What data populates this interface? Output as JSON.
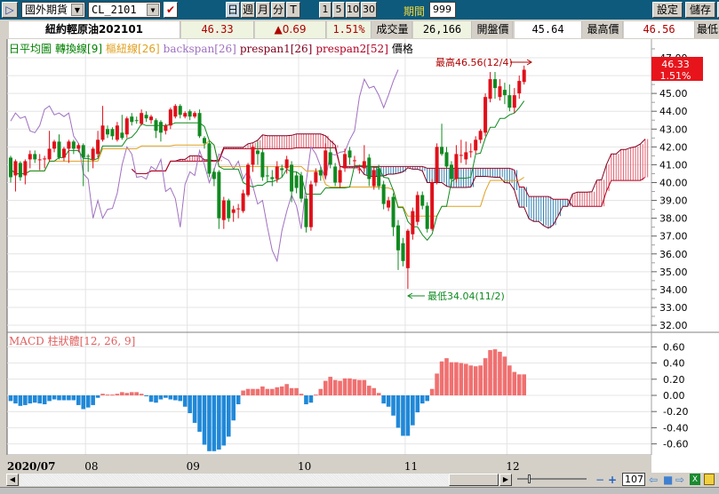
{
  "toolbar": {
    "play_icon": "play-icon",
    "market_select": "國外期貨",
    "symbol_input": "CL_2101",
    "checkbox_checked": true,
    "period_buttons": [
      "日",
      "週",
      "月",
      "分",
      "T"
    ],
    "active_period": "日",
    "count_buttons": [
      "1",
      "5",
      "10",
      "30"
    ],
    "period_label": "期間",
    "period_value": "999",
    "settings_label": "設定",
    "save_label": "儲存"
  },
  "info": {
    "name": "紐約輕原油202101",
    "last": "46.33",
    "change": "▲0.69",
    "change_pct": "1.51%",
    "volume_label": "成交量",
    "volume": "26,166",
    "open_label": "開盤價",
    "open": "45.64",
    "high_label": "最高價",
    "high": "46.56",
    "low_label": "最低"
  },
  "legend": [
    {
      "text": "日平均圖",
      "color": "#008000"
    },
    {
      "text": "轉換線[9]",
      "color": "#008000"
    },
    {
      "text": "樞紐線[26]",
      "color": "#e0a020"
    },
    {
      "text": "backspan[26]",
      "color": "#a070c0"
    },
    {
      "text": "prespan1[26]",
      "color": "#800020"
    },
    {
      "text": "prespan2[52]",
      "color": "#b00020"
    },
    {
      "text": "價格",
      "color": "#000000"
    }
  ],
  "price_tag": {
    "value": "46.33",
    "pct": "1.51%"
  },
  "annotations": {
    "high": "最高46.56(12/4)",
    "low": "最低34.04(11/2)"
  },
  "macd_title": "MACD 柱狀體[12, 26, 9]",
  "colors": {
    "up": "#e0101a",
    "down": "#108a20",
    "tenkan": "#108a20",
    "kijun": "#e0a020",
    "chikou": "#a070c0",
    "span_a": "#800020",
    "span_b": "#b00020",
    "cloud_up": "#e06070",
    "cloud_down": "#3080b0",
    "macd_pos": "#f07070",
    "macd_neg": "#2088d8"
  },
  "chart_data": [
    {
      "type": "candlestick",
      "title": "",
      "ylim": [
        32,
        47
      ],
      "yticks": [
        "47.00",
        "46.00",
        "45.00",
        "44.00",
        "43.00",
        "42.00",
        "41.00",
        "40.00",
        "39.00",
        "38.00",
        "37.00",
        "36.00",
        "35.00",
        "34.00",
        "33.00",
        "32.00"
      ],
      "xtick_labels": [
        {
          "index": 0,
          "label": "2020/07"
        },
        {
          "index": 16,
          "label": "08"
        },
        {
          "index": 37,
          "label": "09"
        },
        {
          "index": 60,
          "label": "10"
        },
        {
          "index": 82,
          "label": "11"
        },
        {
          "index": 103,
          "label": "12"
        }
      ],
      "ohlc": [
        [
          41.4,
          41.5,
          40.0,
          40.3
        ],
        [
          40.4,
          41.3,
          39.5,
          41.2
        ],
        [
          41.1,
          41.2,
          40.1,
          40.3
        ],
        [
          40.4,
          41.3,
          39.9,
          41.2
        ],
        [
          41.3,
          41.8,
          40.8,
          41.6
        ],
        [
          41.6,
          41.8,
          41.1,
          41.3
        ],
        [
          41.3,
          41.6,
          40.7,
          41.3
        ],
        [
          41.3,
          41.5,
          40.8,
          41.35
        ],
        [
          41.3,
          42.9,
          41.2,
          41.9
        ],
        [
          41.9,
          42.4,
          41.7,
          42.3
        ],
        [
          42.3,
          42.7,
          41.3,
          41.4
        ],
        [
          41.4,
          42.0,
          41.2,
          41.9
        ],
        [
          41.9,
          42.4,
          41.1,
          42.3
        ],
        [
          42.3,
          42.4,
          41.6,
          41.9
        ],
        [
          41.9,
          42.2,
          41.7,
          42.1
        ],
        [
          42.1,
          42.2,
          39.8,
          41.4
        ],
        [
          41.5,
          41.6,
          40.6,
          41.45
        ],
        [
          41.3,
          42.0,
          40.8,
          41.9
        ],
        [
          41.6,
          42.9,
          41.4,
          42.4
        ],
        [
          42.4,
          44.3,
          42.3,
          43.2
        ],
        [
          43.0,
          43.2,
          42.5,
          42.7
        ],
        [
          43.0,
          43.1,
          42.4,
          42.6
        ],
        [
          42.4,
          43.4,
          42.3,
          43.2
        ],
        [
          42.8,
          43.8,
          42.4,
          42.5
        ],
        [
          42.7,
          43.7,
          42.5,
          43.6
        ],
        [
          43.7,
          43.9,
          43.2,
          43.4
        ],
        [
          43.5,
          43.7,
          43.3,
          43.45
        ],
        [
          43.3,
          44.1,
          43.2,
          43.9
        ],
        [
          43.8,
          44.0,
          43.4,
          43.6
        ],
        [
          43.5,
          43.8,
          43.3,
          43.7
        ],
        [
          43.5,
          43.6,
          42.5,
          42.9
        ],
        [
          43.4,
          43.5,
          42.3,
          42.8
        ],
        [
          42.9,
          43.3,
          42.7,
          43.2
        ],
        [
          43.2,
          44.2,
          43.0,
          44.1
        ],
        [
          43.7,
          44.4,
          43.6,
          44.3
        ],
        [
          44.3,
          44.4,
          43.6,
          43.8
        ],
        [
          43.7,
          44.0,
          43.6,
          43.9
        ],
        [
          44.0,
          44.1,
          43.5,
          43.7
        ],
        [
          43.7,
          44.0,
          43.6,
          43.9
        ],
        [
          43.9,
          44.1,
          42.5,
          42.6
        ],
        [
          42.5,
          42.6,
          41.9,
          42.2
        ],
        [
          42.2,
          42.3,
          40.3,
          40.5
        ],
        [
          40.6,
          40.8,
          39.8,
          40.2
        ],
        [
          40.6,
          40.7,
          37.4,
          38.0
        ],
        [
          37.9,
          39.2,
          37.4,
          39.0
        ],
        [
          39.0,
          39.1,
          37.8,
          38.0
        ],
        [
          38.3,
          38.7,
          37.8,
          38.5
        ],
        [
          38.5,
          38.8,
          38.0,
          38.55
        ],
        [
          38.4,
          39.6,
          38.3,
          39.4
        ],
        [
          39.3,
          41.1,
          39.2,
          41.0
        ],
        [
          41.0,
          42.1,
          40.6,
          42.0
        ],
        [
          41.8,
          42.3,
          41.0,
          41.6
        ],
        [
          41.7,
          41.9,
          40.1,
          40.3
        ],
        [
          40.4,
          40.9,
          40.0,
          40.35
        ],
        [
          40.3,
          40.7,
          39.8,
          40.2
        ],
        [
          40.2,
          41.2,
          40.0,
          40.9
        ],
        [
          40.8,
          41.0,
          40.3,
          40.7
        ],
        [
          40.8,
          41.5,
          40.5,
          41.3
        ],
        [
          41.0,
          41.2,
          38.9,
          39.5
        ],
        [
          40.4,
          40.6,
          39.4,
          39.7
        ],
        [
          40.4,
          40.6,
          38.9,
          39.1
        ],
        [
          39.1,
          39.3,
          37.2,
          37.5
        ],
        [
          37.5,
          40.1,
          37.3,
          39.9
        ],
        [
          40.0,
          40.8,
          39.8,
          40.6
        ],
        [
          40.7,
          40.9,
          40.1,
          40.4
        ],
        [
          40.4,
          42.2,
          40.2,
          41.8
        ],
        [
          41.7,
          42.0,
          40.8,
          41.0
        ],
        [
          40.9,
          41.1,
          39.8,
          40.0
        ],
        [
          40.0,
          40.9,
          39.7,
          40.7
        ],
        [
          40.8,
          41.9,
          40.6,
          41.6
        ],
        [
          41.8,
          42.0,
          41.0,
          41.4
        ],
        [
          41.2,
          41.5,
          40.9,
          41.25
        ],
        [
          40.7,
          41.0,
          40.5,
          40.75
        ],
        [
          40.8,
          42.1,
          40.6,
          41.2
        ],
        [
          41.4,
          41.6,
          39.8,
          40.2
        ],
        [
          39.8,
          40.9,
          39.6,
          40.7
        ],
        [
          40.8,
          41.0,
          39.6,
          39.8
        ],
        [
          39.9,
          40.1,
          38.5,
          38.8
        ],
        [
          38.6,
          39.2,
          38.4,
          39.0
        ],
        [
          39.2,
          39.4,
          37.0,
          37.5
        ],
        [
          37.6,
          37.9,
          35.1,
          36.2
        ],
        [
          36.6,
          36.9,
          35.3,
          35.6
        ],
        [
          35.2,
          37.4,
          34.04,
          37.3
        ],
        [
          37.1,
          38.6,
          36.8,
          38.4
        ],
        [
          37.8,
          39.5,
          37.6,
          39.3
        ],
        [
          39.3,
          39.5,
          38.5,
          38.7
        ],
        [
          38.7,
          38.9,
          37.2,
          37.4
        ],
        [
          37.4,
          40.2,
          37.3,
          40.0
        ],
        [
          40.0,
          42.2,
          39.9,
          42.0
        ],
        [
          42.0,
          43.3,
          41.5,
          41.6
        ],
        [
          41.7,
          42.0,
          40.8,
          40.9
        ],
        [
          41.0,
          41.2,
          40.0,
          40.2
        ],
        [
          40.2,
          42.1,
          40.0,
          41.6
        ],
        [
          41.5,
          42.4,
          41.1,
          41.55
        ],
        [
          41.3,
          42.3,
          41.0,
          41.7
        ],
        [
          41.7,
          42.2,
          41.4,
          41.75
        ],
        [
          41.8,
          42.6,
          41.6,
          42.4
        ],
        [
          42.4,
          43.0,
          42.2,
          42.9
        ],
        [
          42.8,
          45.0,
          42.6,
          44.8
        ],
        [
          44.7,
          46.2,
          44.5,
          45.8
        ],
        [
          45.8,
          46.2,
          44.7,
          45.3
        ],
        [
          44.8,
          45.8,
          44.6,
          45.4
        ],
        [
          45.2,
          45.6,
          44.4,
          44.9
        ],
        [
          44.9,
          45.5,
          44.0,
          44.2
        ],
        [
          44.2,
          45.3,
          43.9,
          44.9
        ],
        [
          45.0,
          46.0,
          44.7,
          45.7
        ],
        [
          45.64,
          46.56,
          45.5,
          46.33
        ]
      ]
    },
    {
      "type": "bar",
      "title": "MACD 柱狀體[12, 26, 9]",
      "ylim": [
        -0.7,
        0.7
      ],
      "yticks": [
        "0.60",
        "0.40",
        "0.20",
        "0.00",
        "-0.20",
        "-0.40",
        "-0.60"
      ],
      "values": [
        -0.07,
        -0.1,
        -0.13,
        -0.12,
        -0.1,
        -0.09,
        -0.1,
        -0.11,
        -0.07,
        -0.05,
        -0.06,
        -0.06,
        -0.06,
        -0.06,
        -0.12,
        -0.17,
        -0.15,
        -0.12,
        -0.03,
        0.02,
        0.01,
        0.01,
        0.02,
        0.04,
        0.03,
        0.04,
        0.04,
        0.02,
        -0.01,
        -0.08,
        -0.09,
        -0.05,
        -0.03,
        -0.05,
        -0.06,
        -0.07,
        -0.14,
        -0.22,
        -0.34,
        -0.45,
        -0.61,
        -0.69,
        -0.69,
        -0.67,
        -0.62,
        -0.51,
        -0.31,
        -0.11,
        0.06,
        0.08,
        0.08,
        0.08,
        0.11,
        0.08,
        0.08,
        0.1,
        0.11,
        0.14,
        0.09,
        0.09,
        0.02,
        -0.11,
        -0.09,
        0.01,
        0.08,
        0.18,
        0.23,
        0.19,
        0.18,
        0.21,
        0.21,
        0.2,
        0.19,
        0.19,
        0.12,
        0.09,
        0.03,
        -0.1,
        -0.14,
        -0.25,
        -0.4,
        -0.5,
        -0.5,
        -0.37,
        -0.21,
        -0.1,
        -0.07,
        0.08,
        0.27,
        0.42,
        0.46,
        0.41,
        0.41,
        0.4,
        0.39,
        0.37,
        0.36,
        0.37,
        0.46,
        0.56,
        0.57,
        0.54,
        0.48,
        0.37,
        0.29,
        0.26,
        0.26
      ]
    }
  ],
  "bottom": {
    "zoom_value": "107"
  }
}
